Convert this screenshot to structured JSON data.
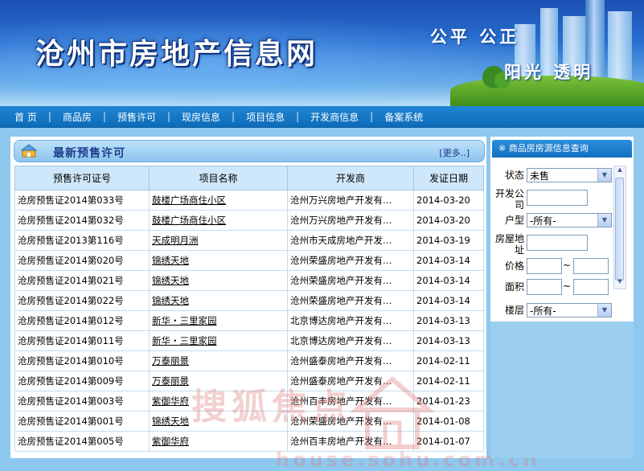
{
  "header": {
    "site_title": "沧州市房地产信息网",
    "slogan_line1": "公平  公正",
    "slogan_line2": "阳光  透明"
  },
  "nav": {
    "items": [
      {
        "label": "首  页"
      },
      {
        "label": "商品房"
      },
      {
        "label": "预售许可"
      },
      {
        "label": "现房信息"
      },
      {
        "label": "项目信息"
      },
      {
        "label": "开发商信息"
      },
      {
        "label": "备案系统"
      }
    ]
  },
  "presale_panel": {
    "title": "最新预售许可",
    "more_label": "[更多..]",
    "columns": [
      "预售许可证号",
      "项目名称",
      "开发商",
      "发证日期"
    ],
    "rows": [
      {
        "permit": "沧房预售证2014第033号",
        "project": "鼓楼广场商住小区",
        "developer": "沧州万兴房地产开发有…",
        "date": "2014-03-20"
      },
      {
        "permit": "沧房预售证2014第032号",
        "project": "鼓楼广场商住小区",
        "developer": "沧州万兴房地产开发有…",
        "date": "2014-03-20"
      },
      {
        "permit": "沧房预售证2013第116号",
        "project": "天成明月洲",
        "developer": "沧州市天成房地产开发…",
        "date": "2014-03-19"
      },
      {
        "permit": "沧房预售证2014第020号",
        "project": "锦绣天地",
        "developer": "沧州荣盛房地产开发有…",
        "date": "2014-03-14"
      },
      {
        "permit": "沧房预售证2014第021号",
        "project": "锦绣天地",
        "developer": "沧州荣盛房地产开发有…",
        "date": "2014-03-14"
      },
      {
        "permit": "沧房预售证2014第022号",
        "project": "锦绣天地",
        "developer": "沧州荣盛房地产开发有…",
        "date": "2014-03-14"
      },
      {
        "permit": "沧房预售证2014第012号",
        "project": "新华・三里家园",
        "developer": "北京博达房地产开发有…",
        "date": "2014-03-13"
      },
      {
        "permit": "沧房预售证2014第011号",
        "project": "新华・三里家园",
        "developer": "北京博达房地产开发有…",
        "date": "2014-03-13"
      },
      {
        "permit": "沧房预售证2014第010号",
        "project": "万泰丽景",
        "developer": "沧州盛泰房地产开发有…",
        "date": "2014-02-11"
      },
      {
        "permit": "沧房预售证2014第009号",
        "project": "万泰丽景",
        "developer": "沧州盛泰房地产开发有…",
        "date": "2014-02-11"
      },
      {
        "permit": "沧房预售证2014第003号",
        "project": "紫御华府",
        "developer": "沧州百丰房地产开发有…",
        "date": "2014-01-23"
      },
      {
        "permit": "沧房预售证2014第001号",
        "project": "锦绣天地",
        "developer": "沧州荣盛房地产开发有…",
        "date": "2014-01-08"
      },
      {
        "permit": "沧房预售证2014第005号",
        "project": "紫御华府",
        "developer": "沧州百丰房地产开发有…",
        "date": "2014-01-07"
      }
    ]
  },
  "watermark": {
    "text": "搜狐焦点",
    "url": "house.sohu.com.cn"
  },
  "search_panel": {
    "title": "※ 商品房房源信息查询",
    "status_label": "状态",
    "status_value": "未售",
    "developer_label": "开发公司",
    "type_label": "户型",
    "type_value": "-所有-",
    "address_label": "房屋地址",
    "price_label": "价格",
    "area_label": "面积",
    "range_sep": "~",
    "floor_label": "楼层",
    "floor_value": "-所有-"
  },
  "colors": {
    "nav_bg": "#1577c6",
    "panel_head": "#a9d4f5",
    "page_bg": "#8ec8ef"
  }
}
